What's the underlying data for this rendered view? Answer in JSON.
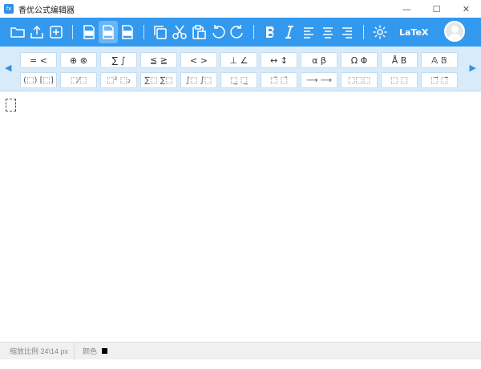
{
  "window": {
    "title": "香优公式编辑器",
    "app_icon_text": "fx",
    "controls": {
      "minimize": "—",
      "maximize": "☐",
      "close": "✕"
    }
  },
  "toolbar": {
    "icon_color": "#ffffff",
    "background": "#3399ee",
    "groups": [
      [
        "open-file-icon",
        "upload-icon",
        "new-file-icon"
      ],
      [
        "export-png-icon",
        "export-svg-icon",
        "export-tex-icon"
      ],
      [
        "copy-icon",
        "cut-icon",
        "paste-icon",
        "undo-icon",
        "redo-icon"
      ],
      [
        "bold-icon",
        "italic-icon",
        "align-left-icon",
        "align-center-icon",
        "align-right-icon"
      ],
      [
        "settings-icon"
      ]
    ],
    "active": "export-svg-icon",
    "latex_label": "LaTeX"
  },
  "palette": {
    "prev_arrow": "◀",
    "next_arrow": "▶",
    "row1": [
      {
        "name": "equal-less-symbols",
        "label": "= <"
      },
      {
        "name": "circle-operators",
        "label": "⊕ ⊗"
      },
      {
        "name": "sum-integral-symbols",
        "label": "∑ ∫"
      },
      {
        "name": "inequality-symbols",
        "label": "≦ ≧"
      },
      {
        "name": "angle-bracket-symbols",
        "label": "< >"
      },
      {
        "name": "geometry-symbols",
        "label": "⊥ ∠"
      },
      {
        "name": "arrow-symbols",
        "label": "↔ ↕"
      },
      {
        "name": "greek-lowercase",
        "label": "α β"
      },
      {
        "name": "greek-uppercase",
        "label": "Ω Φ"
      },
      {
        "name": "accented-letters",
        "label": "Å B"
      },
      {
        "name": "font-style-letters",
        "label": "𝔸 𝔹"
      }
    ],
    "row2": [
      {
        "name": "fence-templates",
        "label": "(⬚) [⬚]"
      },
      {
        "name": "fraction-templates",
        "label": "⬚⁄⬚"
      },
      {
        "name": "script-templates",
        "label": "⬚² ⬚₂"
      },
      {
        "name": "summation-templates",
        "label": "∑⬚ ∑⬚"
      },
      {
        "name": "integral-templates",
        "label": "∫⬚ ∫⬚"
      },
      {
        "name": "bar-templates",
        "label": "⬚̲ ⬚̲"
      },
      {
        "name": "over-arrow-templates",
        "label": "⬚̃ ⬚̂"
      },
      {
        "name": "labeled-arrow-templates",
        "label": "⟶ ⟶"
      },
      {
        "name": "matrix-templates",
        "label": "⬚⬚⬚"
      },
      {
        "name": "box-templates",
        "label": "⬚ ⬚"
      },
      {
        "name": "vector-templates",
        "label": "⬚⃗ ⬚⃗"
      }
    ]
  },
  "status": {
    "zoom": "缩放比例 24\\14 px",
    "color_label": "颜色",
    "color_value": "#000000"
  }
}
